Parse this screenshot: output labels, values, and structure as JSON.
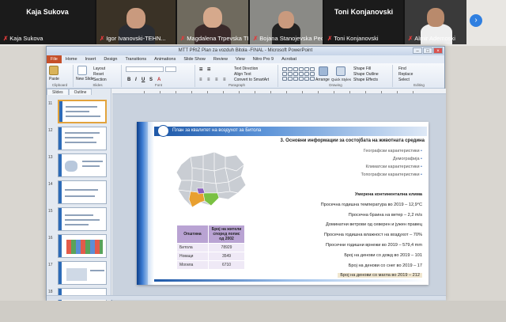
{
  "meeting": {
    "participants": [
      {
        "name": "Kaja Sukova",
        "caption": "Kaja Sukova",
        "video": false
      },
      {
        "name": "Igor Ivanovski-TEHN...",
        "caption": "Igor Ivanovski-TEHN...",
        "video": true
      },
      {
        "name": "Magdalena Trpevska TE...",
        "caption": "Magdalena Trpevska TE...",
        "video": true
      },
      {
        "name": "Bojana Stanojevska Pecu...",
        "caption": "Bojana Stanojevska Pecu...",
        "video": true
      },
      {
        "name": "Toni Konjanovski",
        "caption": "Toni Konjanovski",
        "video": false
      },
      {
        "name": "Almir Ademoski",
        "caption": "Almir Ademoski",
        "video": true
      }
    ],
    "next_icon": "chevron-right-icon"
  },
  "ppt": {
    "window_title": "MTT PRIZ Plan za vozduh Bitola -FINAL - Microsoft PowerPoint",
    "tabs": [
      "File",
      "Home",
      "Insert",
      "Design",
      "Transitions",
      "Animations",
      "Slide Show",
      "Review",
      "View",
      "Nitro Pro 9",
      "Acrobat"
    ],
    "ribbon": {
      "paste": "Paste",
      "clipboard": "Clipboard",
      "new_slide": "New Slide",
      "layout": "Layout",
      "reset": "Reset",
      "section": "Section",
      "slides": "Slides",
      "font": "Font",
      "paragraph": "Paragraph",
      "text_direction": "Text Direction",
      "align_text": "Align Text",
      "convert_smartart": "Convert to SmartArt",
      "drawing": "Drawing",
      "arrange": "Arrange",
      "quick_styles": "Quick Styles",
      "shape_fill": "Shape Fill",
      "shape_outline": "Shape Outline",
      "shape_effects": "Shape Effects",
      "find": "Find",
      "replace": "Replace",
      "select": "Select",
      "editing": "Editing"
    },
    "pane_tabs": [
      "Slides",
      "Outline"
    ],
    "slide_numbers": [
      "11",
      "12",
      "13",
      "14",
      "15",
      "16",
      "17",
      "18"
    ],
    "selected_slide": "11"
  },
  "slide": {
    "header": "План за квалитет на воздухот за Битола",
    "section_title": "3. Основни информации за состојбата на животната средина",
    "bullets": [
      "Географски карактеристики",
      "Демографија",
      "Климатски карактеристики",
      "Топографски карактеристики"
    ],
    "climate": "Умерена континентална клима",
    "stats": [
      {
        "text": "Просечна годишна температура во 2019 – 12,9°C"
      },
      {
        "text": "Просечна брзина на ветер – 2,2 m/s"
      },
      {
        "text": "Доминатни ветрови од северен и јужен правец"
      },
      {
        "text": "Просечна годишна влажност на воздухот – 70%"
      },
      {
        "text": "Просечни годишни врнежи во 2019 – 579,4 mm"
      },
      {
        "text": "Број на денови со дожд во 2019 – 101"
      },
      {
        "text": "Број на денови со снег во 2019 – 17"
      },
      {
        "text": "Број на денови со магла во 2019 – 212"
      }
    ],
    "table": {
      "headers": [
        "Општина",
        "Број на жители според попис од 2002"
      ],
      "rows": [
        [
          "Битола",
          "78929"
        ],
        [
          "Новаци",
          "3549"
        ],
        [
          "Могила",
          "6710"
        ]
      ]
    },
    "map_colors": {
      "bitola": "#e8a030",
      "novaci": "#7ac143",
      "mogila": "#8b5fbf",
      "base": "#c9cdd3"
    }
  }
}
